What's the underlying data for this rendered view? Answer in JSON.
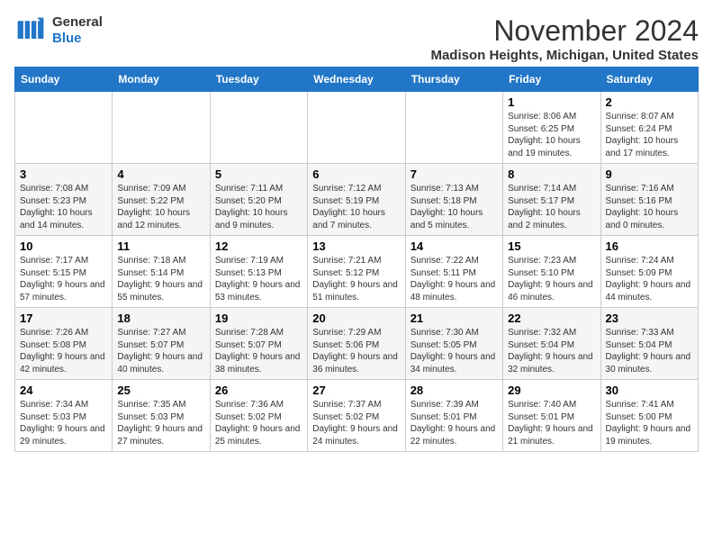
{
  "header": {
    "logo_line1": "General",
    "logo_line2": "Blue",
    "month_title": "November 2024",
    "location": "Madison Heights, Michigan, United States"
  },
  "weekdays": [
    "Sunday",
    "Monday",
    "Tuesday",
    "Wednesday",
    "Thursday",
    "Friday",
    "Saturday"
  ],
  "weeks": [
    [
      {
        "day": "",
        "info": ""
      },
      {
        "day": "",
        "info": ""
      },
      {
        "day": "",
        "info": ""
      },
      {
        "day": "",
        "info": ""
      },
      {
        "day": "",
        "info": ""
      },
      {
        "day": "1",
        "info": "Sunrise: 8:06 AM\nSunset: 6:25 PM\nDaylight: 10 hours and 19 minutes."
      },
      {
        "day": "2",
        "info": "Sunrise: 8:07 AM\nSunset: 6:24 PM\nDaylight: 10 hours and 17 minutes."
      }
    ],
    [
      {
        "day": "3",
        "info": "Sunrise: 7:08 AM\nSunset: 5:23 PM\nDaylight: 10 hours and 14 minutes."
      },
      {
        "day": "4",
        "info": "Sunrise: 7:09 AM\nSunset: 5:22 PM\nDaylight: 10 hours and 12 minutes."
      },
      {
        "day": "5",
        "info": "Sunrise: 7:11 AM\nSunset: 5:20 PM\nDaylight: 10 hours and 9 minutes."
      },
      {
        "day": "6",
        "info": "Sunrise: 7:12 AM\nSunset: 5:19 PM\nDaylight: 10 hours and 7 minutes."
      },
      {
        "day": "7",
        "info": "Sunrise: 7:13 AM\nSunset: 5:18 PM\nDaylight: 10 hours and 5 minutes."
      },
      {
        "day": "8",
        "info": "Sunrise: 7:14 AM\nSunset: 5:17 PM\nDaylight: 10 hours and 2 minutes."
      },
      {
        "day": "9",
        "info": "Sunrise: 7:16 AM\nSunset: 5:16 PM\nDaylight: 10 hours and 0 minutes."
      }
    ],
    [
      {
        "day": "10",
        "info": "Sunrise: 7:17 AM\nSunset: 5:15 PM\nDaylight: 9 hours and 57 minutes."
      },
      {
        "day": "11",
        "info": "Sunrise: 7:18 AM\nSunset: 5:14 PM\nDaylight: 9 hours and 55 minutes."
      },
      {
        "day": "12",
        "info": "Sunrise: 7:19 AM\nSunset: 5:13 PM\nDaylight: 9 hours and 53 minutes."
      },
      {
        "day": "13",
        "info": "Sunrise: 7:21 AM\nSunset: 5:12 PM\nDaylight: 9 hours and 51 minutes."
      },
      {
        "day": "14",
        "info": "Sunrise: 7:22 AM\nSunset: 5:11 PM\nDaylight: 9 hours and 48 minutes."
      },
      {
        "day": "15",
        "info": "Sunrise: 7:23 AM\nSunset: 5:10 PM\nDaylight: 9 hours and 46 minutes."
      },
      {
        "day": "16",
        "info": "Sunrise: 7:24 AM\nSunset: 5:09 PM\nDaylight: 9 hours and 44 minutes."
      }
    ],
    [
      {
        "day": "17",
        "info": "Sunrise: 7:26 AM\nSunset: 5:08 PM\nDaylight: 9 hours and 42 minutes."
      },
      {
        "day": "18",
        "info": "Sunrise: 7:27 AM\nSunset: 5:07 PM\nDaylight: 9 hours and 40 minutes."
      },
      {
        "day": "19",
        "info": "Sunrise: 7:28 AM\nSunset: 5:07 PM\nDaylight: 9 hours and 38 minutes."
      },
      {
        "day": "20",
        "info": "Sunrise: 7:29 AM\nSunset: 5:06 PM\nDaylight: 9 hours and 36 minutes."
      },
      {
        "day": "21",
        "info": "Sunrise: 7:30 AM\nSunset: 5:05 PM\nDaylight: 9 hours and 34 minutes."
      },
      {
        "day": "22",
        "info": "Sunrise: 7:32 AM\nSunset: 5:04 PM\nDaylight: 9 hours and 32 minutes."
      },
      {
        "day": "23",
        "info": "Sunrise: 7:33 AM\nSunset: 5:04 PM\nDaylight: 9 hours and 30 minutes."
      }
    ],
    [
      {
        "day": "24",
        "info": "Sunrise: 7:34 AM\nSunset: 5:03 PM\nDaylight: 9 hours and 29 minutes."
      },
      {
        "day": "25",
        "info": "Sunrise: 7:35 AM\nSunset: 5:03 PM\nDaylight: 9 hours and 27 minutes."
      },
      {
        "day": "26",
        "info": "Sunrise: 7:36 AM\nSunset: 5:02 PM\nDaylight: 9 hours and 25 minutes."
      },
      {
        "day": "27",
        "info": "Sunrise: 7:37 AM\nSunset: 5:02 PM\nDaylight: 9 hours and 24 minutes."
      },
      {
        "day": "28",
        "info": "Sunrise: 7:39 AM\nSunset: 5:01 PM\nDaylight: 9 hours and 22 minutes."
      },
      {
        "day": "29",
        "info": "Sunrise: 7:40 AM\nSunset: 5:01 PM\nDaylight: 9 hours and 21 minutes."
      },
      {
        "day": "30",
        "info": "Sunrise: 7:41 AM\nSunset: 5:00 PM\nDaylight: 9 hours and 19 minutes."
      }
    ]
  ]
}
